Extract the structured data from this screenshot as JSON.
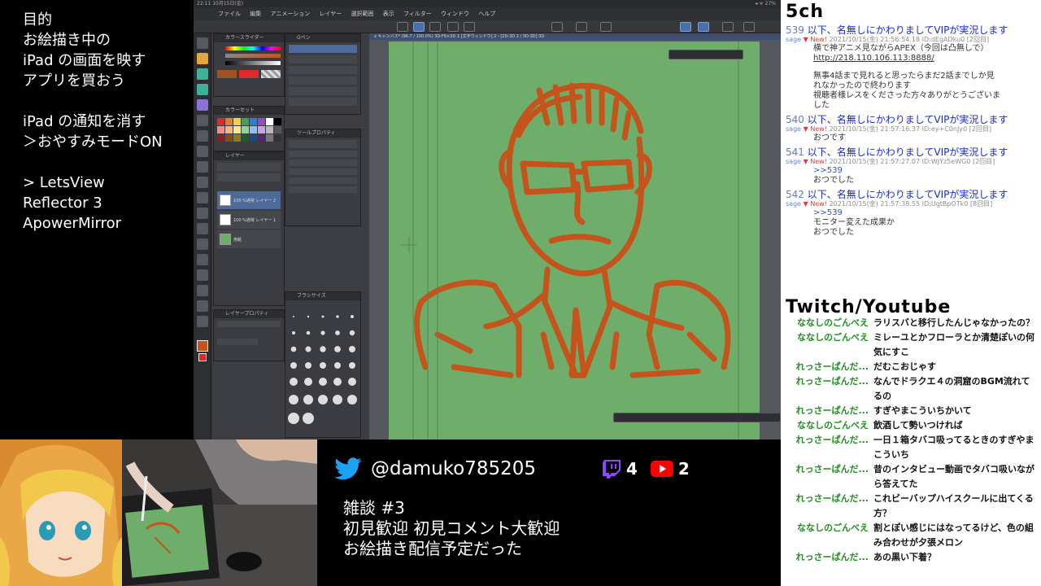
{
  "notes": {
    "lines_a": [
      "目的",
      "お絵描き中の",
      "iPad の画面を映す",
      "アプリを買おう"
    ],
    "lines_b": [
      "iPad の通知を消す",
      "＞おやすみモードON"
    ],
    "lines_c": [
      "> LetsView",
      "Reflector 3",
      "ApowerMirror"
    ]
  },
  "ipad": {
    "status_time": "22:11  10月15日(金)",
    "status_right": "◂ ᯤ 27%",
    "menu": [
      "ファイル",
      "編集",
      "アニメーション",
      "レイヤー",
      "選択範囲",
      "表示",
      "フィルター",
      "ウィンドウ",
      "ヘルプ"
    ],
    "canvas_tab": "x キャンバス* (96.7 / 100.0%) 3D-F6×3D 1 [文字ウィンドウ] 2 - [2D-3D 2 / 3D-3D] 3D",
    "panels": {
      "color": "カラースライダー",
      "brush": "Gペン",
      "colorset": "カラーセット",
      "toolprop": "ツールプロパティ",
      "layer": "レイヤー",
      "layerprop": "レイヤープロパティ",
      "brushsize": "ブラシサイズ"
    },
    "layers": [
      "100 %通常 レイヤー 2",
      "100 %通常 レイヤー 1",
      "用紙"
    ]
  },
  "fivech": {
    "title": "5ch",
    "posts": [
      {
        "num": "539",
        "subject": "以下、名無しにかわりましてVIPが実況します",
        "meta_sage": "sage",
        "meta_new": "▼ New!",
        "meta_date": "2021/10/15(金) 21:56:54.18 ID:dEgADku0 [2回目]",
        "body_lines": [
          "横で神アニメ見ながらAPEX（今回は凸無しで）"
        ],
        "link": "http://218.110.106.113:8888/",
        "body_more": [
          "無事4話まで見れると思ったらまだ2話までしか見",
          "れなかったので終わります",
          "視聴者様レスをくださった方々ありがとうございま",
          "した"
        ]
      },
      {
        "num": "540",
        "subject": "以下、名無しにかわりましてVIPが実況します",
        "meta_sage": "sage",
        "meta_new": "▼ New!",
        "meta_date": "2021/10/15(金) 21:57:16.37 ID:ey+C0nJy0 [2回目]",
        "body_lines": [
          "おつです"
        ]
      },
      {
        "num": "541",
        "subject": "以下、名無しにかわりましてVIPが実況します",
        "meta_sage": "sage",
        "meta_new": "▼ New!",
        "meta_date": "2021/10/15(金) 21:57:27.07 ID:WJYz5eWG0 [2回目]",
        "body_lines": [
          ">>539",
          "おつでした"
        ]
      },
      {
        "num": "542",
        "subject": "以下、名無しにかわりましてVIPが実況します",
        "meta_sage": "sage",
        "meta_new": "▼ New!",
        "meta_date": "2021/10/15(金) 21:57:38.55 ID:UgtBpOTk0 [8回目]",
        "body_lines": [
          ">>539",
          "モニター変えた成果か",
          "おつでした"
        ]
      }
    ]
  },
  "twitch": {
    "title": "Twitch/Youtube",
    "messages": [
      {
        "nick": "ななしのごんべえ",
        "text": "ラリスバと移行したんじゃなかったの？"
      },
      {
        "nick": "ななしのごんべえ",
        "text": "ミレーユとかフローラとか清楚ぽいの何気にすこ"
      },
      {
        "nick": "れっさーぱんだ...",
        "text": "だむこおじゃす"
      },
      {
        "nick": "れっさーぱんだ...",
        "text": "なんでドラクエ４の洞窟のBGM流れてるの"
      },
      {
        "nick": "れっさーぱんだ...",
        "text": "すぎやまこういちかいて"
      },
      {
        "nick": "ななしのごんべえ",
        "text": "飲酒して勢いつければ"
      },
      {
        "nick": "れっさーぱんだ...",
        "text": "一日１箱タバコ吸ってるときのすぎやまこういち"
      },
      {
        "nick": "れっさーぱんだ...",
        "text": "昔のインタビュー動画でタバコ吸いながら答えてた"
      },
      {
        "nick": "れっさーぱんだ...",
        "text": "これビーバップハイスクールに出てくる方？"
      },
      {
        "nick": "ななしのごんべえ",
        "text": "割とぽい感じにはなってるけど、色の組み合わせが夕張メロン"
      },
      {
        "nick": "れっさーぱんだ...",
        "text": "あの黒い下着？"
      }
    ]
  },
  "bottom": {
    "twitter_handle": "@damuko785205",
    "twitch_count": "4",
    "youtube_count": "2",
    "title_lines": [
      "雑談 #3",
      "初見歓迎  初見コメント大歓迎",
      "お絵描き配信予定だった"
    ]
  },
  "colors": {
    "sketch": "#c4541c",
    "canvas_green": "#6fae6a",
    "twitter_blue": "#1da1f2",
    "twitch_purple": "#9146ff",
    "youtube_red": "#ff0000",
    "nick_green": "#1f8f1f",
    "link_blue": "#1a2ad8"
  }
}
